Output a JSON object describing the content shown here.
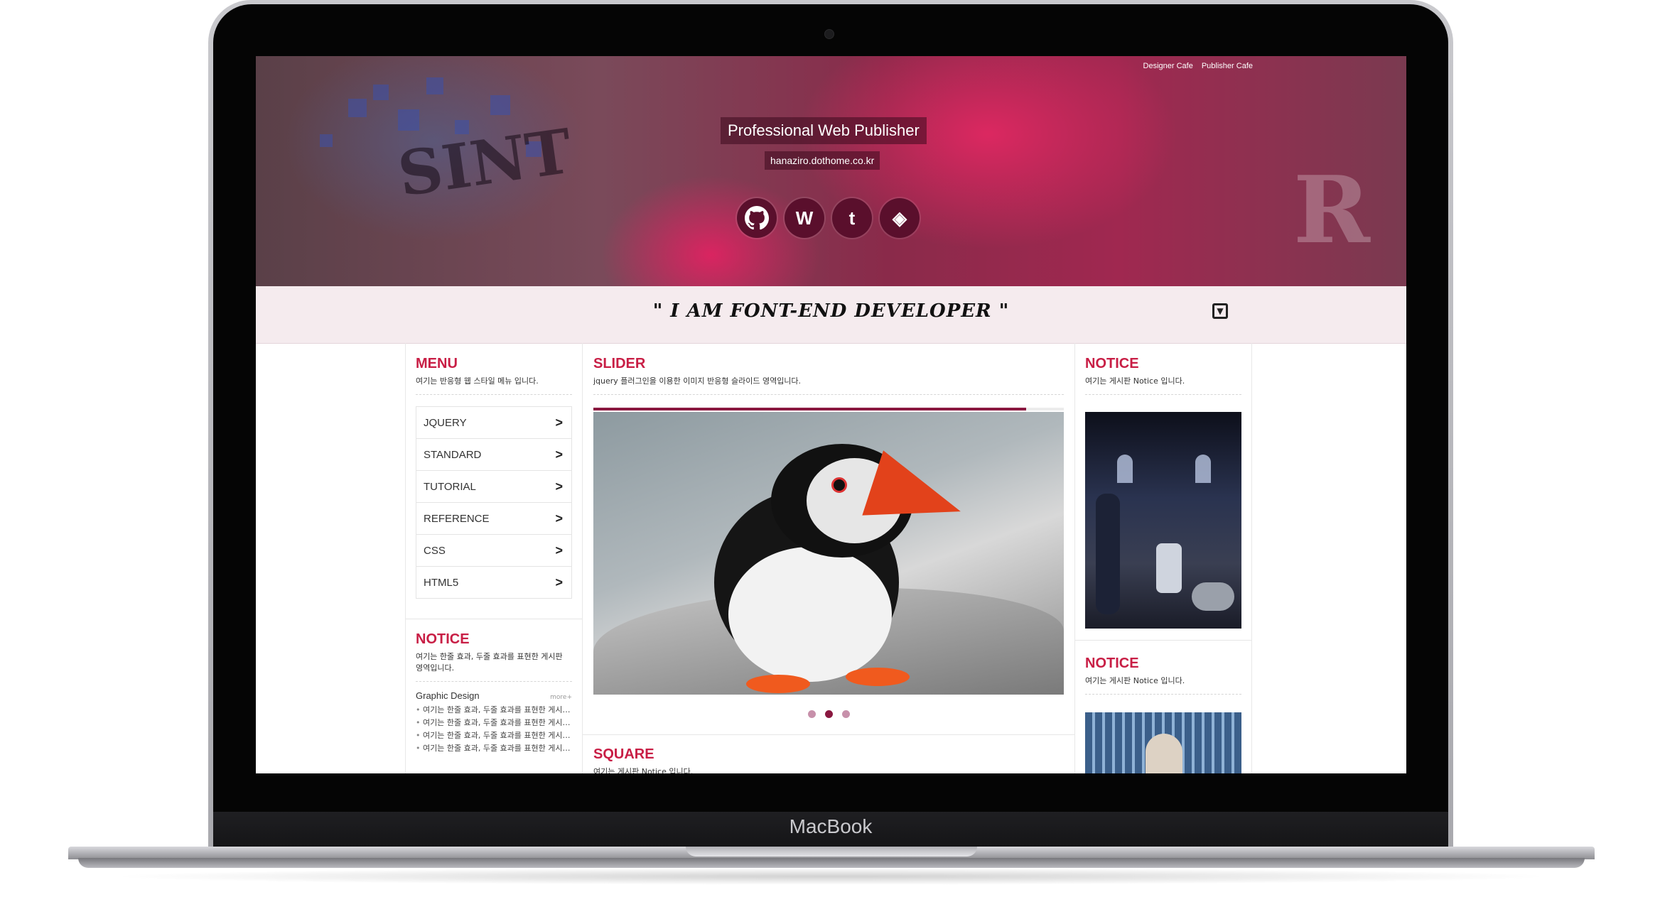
{
  "device": {
    "brand": "MacBook"
  },
  "header": {
    "top_links": [
      "Designer Cafe",
      "Publisher Cafe"
    ],
    "title": "Professional Web Publisher",
    "url": "hanaziro.dothome.co.kr",
    "social_icons": [
      "github-icon",
      "wordpress-icon",
      "tumblr-icon",
      "codepen-icon"
    ],
    "social_glyphs": [
      "",
      "W",
      "t",
      "◈"
    ]
  },
  "banner": {
    "quote": "\" I AM FONT-END DEVELOPER \""
  },
  "left": {
    "menu": {
      "title": "MENU",
      "desc": "여기는 반응형 웹 스타일 메뉴 입니다.",
      "items": [
        {
          "label": "JQUERY"
        },
        {
          "label": "STANDARD"
        },
        {
          "label": "TUTORIAL"
        },
        {
          "label": "REFERENCE"
        },
        {
          "label": "CSS"
        },
        {
          "label": "HTML5"
        }
      ],
      "arrow": ">"
    },
    "notice": {
      "title": "NOTICE",
      "desc": "여기는 한줄 효과, 두줄 효과를 표현한 게시판 영역입니다.",
      "board_title": "Graphic Design",
      "more": "more+",
      "items": [
        "여기는 한줄 효과, 두줄 효과를 표현한 게시판 영역입니다.",
        "여기는 한줄 효과, 두줄 효과를 표현한 게시판 영역입니다.",
        "여기는 한줄 효과, 두줄 효과를 표현한 게시판 영역입니다.",
        "여기는 한줄 효과, 두줄 효과를 표현한 게시판 영역입니다."
      ]
    }
  },
  "middle": {
    "slider": {
      "title": "SLIDER",
      "desc": "jquery 플러그인을 이용한 이미지 반응형 슬라이드 영역입니다.",
      "progress": 0.92,
      "dots": 3,
      "active_dot": 2
    },
    "square": {
      "title": "SQUARE",
      "desc": "여기는 게시판 Notice 입니다."
    }
  },
  "right": {
    "notice1": {
      "title": "NOTICE",
      "desc": "여기는 게시판 Notice 입니다."
    },
    "notice2": {
      "title": "NOTICE",
      "desc": "여기는 게시판 Notice 입니다."
    }
  },
  "colors": {
    "accent": "#c81e45",
    "dark_accent": "#8a1840",
    "banner_bg": "#f5ebee"
  }
}
